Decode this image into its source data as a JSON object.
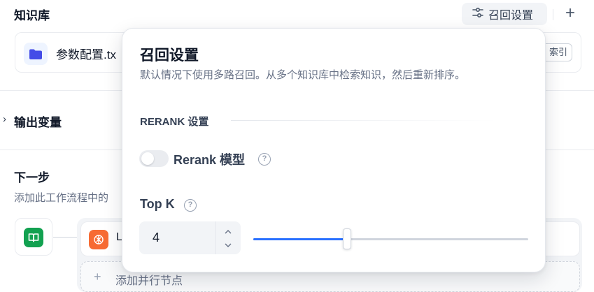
{
  "knowledge": {
    "title": "知识库",
    "recall_button": "召回设置",
    "add_icon": "plus-icon",
    "item": {
      "name": "参数配置.tx",
      "badge": "索引"
    }
  },
  "output": {
    "title": "输出变量"
  },
  "next_step": {
    "title": "下一步",
    "desc": "添加此工作流程中的",
    "node_label": "L",
    "parallel_label": "添加并行节点"
  },
  "popup": {
    "title": "召回设置",
    "desc": "默认情况下使用多路召回。从多个知识库中检索知识，然后重新排序。",
    "rerank_section": "RERANK 设置",
    "rerank_model": "Rerank 模型",
    "rerank_enabled": false,
    "topk_label": "Top K",
    "topk_value": "4",
    "topk_slider_fraction": 0.34
  },
  "colors": {
    "accent": "#2970ff",
    "start_node": "#12a150",
    "llm_node": "#f76b33",
    "folder": "#444ce7"
  }
}
